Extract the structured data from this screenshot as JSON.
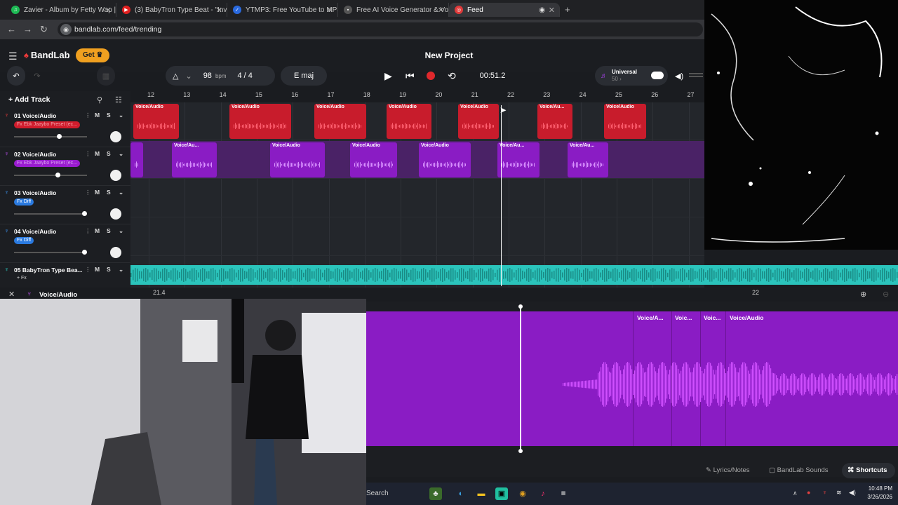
{
  "browser": {
    "tabs": [
      {
        "label": "Zavier - Album by Fetty Wap | S",
        "color": "#1db954",
        "active": false
      },
      {
        "label": "(3) BabyTron Type Beat - \"Invas",
        "color": "#e02020",
        "active": false
      },
      {
        "label": "YTMP3: Free YouTube to MP3 C",
        "color": "#2a6ae0",
        "active": false
      },
      {
        "label": "Free AI Voice Generator & Voic",
        "color": "#444444",
        "active": false
      },
      {
        "label": "Feed",
        "color": "#e03a3a",
        "active": true
      }
    ],
    "url": "bandlab.com/feed/trending"
  },
  "header": {
    "logo": "BandLab",
    "get_label": "Get",
    "project_title": "New Project"
  },
  "transport": {
    "bpm_value": "98",
    "bpm_unit": "bpm",
    "time_sig": "4 / 4",
    "key": "E maj",
    "time": "00:51.2",
    "instrument": "Universal",
    "instrument_sub": "50"
  },
  "ruler": {
    "ticks": [
      "12",
      "13",
      "14",
      "15",
      "16",
      "17",
      "18",
      "19",
      "20",
      "21",
      "22",
      "23",
      "24",
      "25",
      "26",
      "27"
    ]
  },
  "tracks_panel": {
    "add_track": "Add Track",
    "tracks": [
      {
        "name": "01 Voice/Audio",
        "fx": "Fx Ebk Jaaybo Preset (ec...",
        "fx_color": "#d01c2c",
        "level": 0.62,
        "icon_color": "#e03a3a"
      },
      {
        "name": "02 Voice/Audio",
        "fx": "Fx Ebk Jaaybo Preset (ec...",
        "fx_color": "#9a1cd0",
        "level": 0.6,
        "icon_color": "#b04ae0"
      },
      {
        "name": "03 Voice/Audio",
        "fx": "Fx Diff",
        "fx_color": "#2a7ae0",
        "level": 0.96,
        "icon_color": "#3a8ae0"
      },
      {
        "name": "04 Voice/Audio",
        "fx": "Fx Diff",
        "fx_color": "#2a7ae0",
        "level": 0.96,
        "icon_color": "#3a8ae0"
      },
      {
        "name": "05 BabyTron Type Bea...",
        "fx": "+ Fx",
        "fx_color": "transparent",
        "level": null,
        "icon_color": "#2bc4bc"
      }
    ],
    "mute": "M",
    "solo": "S"
  },
  "clip_label": "Voice/Audio",
  "clip_label_short": "Voice/Au...",
  "editor": {
    "track_name": "Voice/Audio",
    "ruler_left": "21.4",
    "ruler_right": "22",
    "clip_labels": [
      "Voice/A...",
      "Voic...",
      "Voic...",
      "Voice/Audio"
    ]
  },
  "bottom_buttons": {
    "lyrics": "Lyrics/Notes",
    "sounds": "BandLab Sounds",
    "shortcuts": "Shortcuts"
  },
  "taskbar": {
    "search": "Search",
    "time": "10:48 PM",
    "date": "3/26/2026"
  },
  "colors": {
    "red_clip": "#c81c2c",
    "purple_clip": "#8a1cc4",
    "teal_clip": "#2bc4bc"
  }
}
